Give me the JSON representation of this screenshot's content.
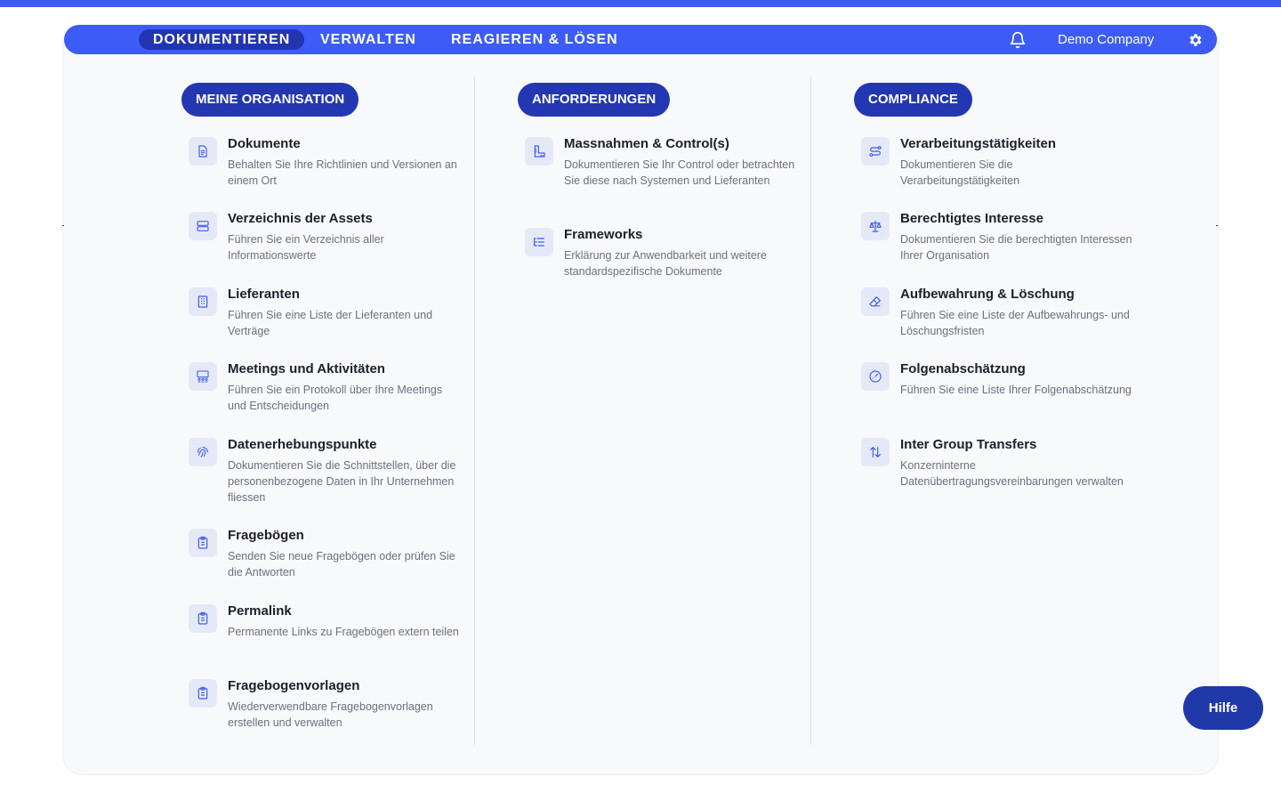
{
  "nav": {
    "tabs": [
      {
        "label": "DOKUMENTIEREN",
        "active": true
      },
      {
        "label": "VERWALTEN",
        "active": false
      },
      {
        "label": "REAGIEREN & LÖSEN",
        "active": false
      }
    ],
    "company": "Demo Company"
  },
  "colors": {
    "brand": "#3d5cf5",
    "pill": "#2337b3",
    "active_tab": "#2235b0",
    "icon_bg": "#e5e9f7",
    "icon_fg": "#3d5cf5"
  },
  "sections": [
    {
      "heading": "MEINE ORGANISATION",
      "items": [
        {
          "title": "Dokumente",
          "desc": "Behalten Sie Ihre Richtlinien und Versionen an einem Ort",
          "icon": "document-icon"
        },
        {
          "title": "Verzeichnis der Assets",
          "desc": "Führen Sie ein Verzeichnis aller Informationswerte",
          "icon": "server-icon"
        },
        {
          "title": "Lieferanten",
          "desc": "Führen Sie eine Liste der Lieferanten und Verträge",
          "icon": "building-icon"
        },
        {
          "title": "Meetings und Aktivitäten",
          "desc": "Führen Sie ein Protokoll über Ihre Meetings und Entscheidungen",
          "icon": "meeting-icon"
        },
        {
          "title": "Datenerhebungspunkte",
          "desc": "Dokumentieren Sie die Schnittstellen, über die personenbezogene Daten in Ihr Unternehmen fliessen",
          "icon": "fingerprint-icon"
        },
        {
          "title": "Fragebögen",
          "desc": "Senden Sie neue Fragebögen oder prüfen Sie die Antworten",
          "icon": "clipboard-icon"
        },
        {
          "title": "Permalink",
          "desc": "Permanente Links zu Fragebögen extern teilen",
          "icon": "clipboard-icon"
        },
        {
          "title": "Fragebogenvorlagen",
          "desc": "Wiederverwendbare Fragebogenvorlagen erstellen und verwalten",
          "icon": "clipboard-icon"
        }
      ]
    },
    {
      "heading": "ANFORDERUNGEN",
      "items": [
        {
          "title": "Massnahmen & Control(s)",
          "desc": "Dokumentieren Sie Ihr Control oder betrachten Sie diese nach Systemen und Lieferanten",
          "icon": "ruler-icon"
        },
        {
          "title": "Frameworks",
          "desc": "Erklärung zur Anwendbarkeit und weitere standardspezifische Dokumente",
          "icon": "list-icon"
        }
      ]
    },
    {
      "heading": "COMPLIANCE",
      "items": [
        {
          "title": "Verarbeitungstätigkeiten",
          "desc": "Dokumentieren Sie die Verarbeitungstätigkeiten",
          "icon": "route-icon"
        },
        {
          "title": "Berechtigtes Interesse",
          "desc": "Dokumentieren Sie die berechtigten Interessen Ihrer Organisation",
          "icon": "scale-icon"
        },
        {
          "title": "Aufbewahrung & Löschung",
          "desc": "Führen Sie eine Liste der Aufbewahrungs- und Löschungsfristen",
          "icon": "eraser-icon"
        },
        {
          "title": "Folgenabschätzung",
          "desc": "Führen Sie eine Liste Ihrer Folgenabschätzung",
          "icon": "gauge-icon"
        },
        {
          "title": "Inter Group Transfers",
          "desc": "Konzerninterne Datenübertragungsvereinbarungen verwalten",
          "icon": "arrows-updown-icon"
        }
      ]
    }
  ],
  "help_label": "Hilfe"
}
